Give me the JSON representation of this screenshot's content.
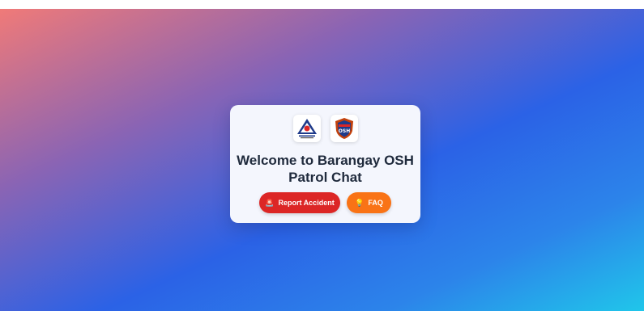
{
  "card": {
    "title": "Welcome to Barangay OSH Patrol Chat",
    "logos": [
      {
        "name": "dole-seal",
        "text": "DEPARTMENT OF LABOR AND EMPLOYMENT"
      },
      {
        "name": "barangay-osh-patrol-badge",
        "text": "BARANGAY OSH PATROL"
      }
    ]
  },
  "buttons": {
    "report_label": "Report Accident",
    "report_icon": "siren-icon",
    "faq_label": "FAQ",
    "faq_icon": "lightbulb-icon"
  },
  "colors": {
    "report": "#dc2626",
    "faq": "#f97316",
    "title": "#1f2a3c",
    "card": "#f4f6fd"
  }
}
